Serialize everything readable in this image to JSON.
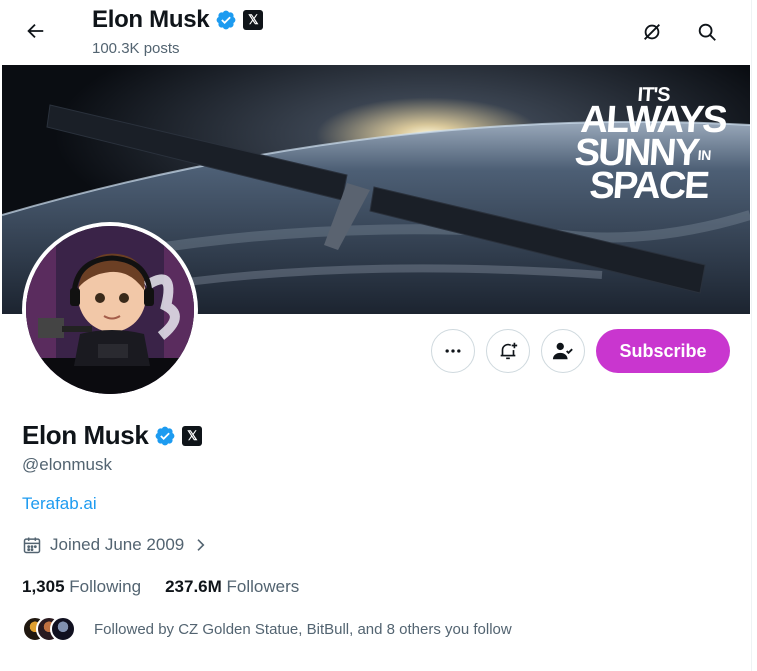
{
  "header": {
    "name": "Elon Musk",
    "posts": "100.3K posts",
    "x_badge": "𝕏"
  },
  "banner": {
    "line1": "IT'S",
    "line2": "ALWAYS",
    "line3": "SUNNY",
    "line3_small": "IN",
    "line4": "SPACE"
  },
  "actions": {
    "subscribe_label": "Subscribe"
  },
  "profile": {
    "name": "Elon Musk",
    "handle": "@elonmusk",
    "website": "Terafab.ai",
    "joined": "Joined June 2009",
    "following_count": "1,305",
    "following_label": "Following",
    "followers_count": "237.6M",
    "followers_label": "Followers",
    "followed_by": "Followed by CZ Golden Statue, BitBull, and 8 others you follow"
  },
  "colors": {
    "accent": "#1d9bf0",
    "subscribe": "#c936cf",
    "verified": "#1d9bf0"
  },
  "icons": [
    "back-arrow-icon",
    "verified-badge-icon",
    "x-logo-icon",
    "grok-icon",
    "search-icon",
    "more-icon",
    "notify-bell-icon",
    "following-person-icon",
    "calendar-icon",
    "chevron-right-icon"
  ]
}
